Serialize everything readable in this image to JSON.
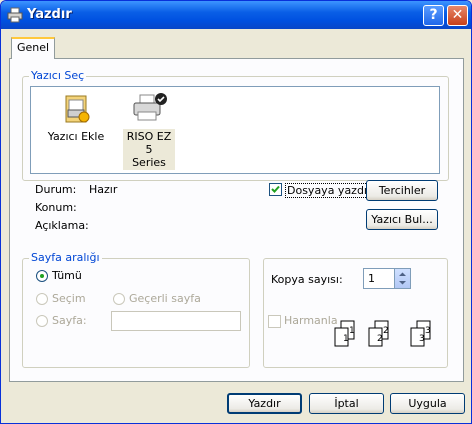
{
  "window": {
    "title": "Yazdır",
    "help_symbol": "?",
    "close_symbol": "✕"
  },
  "tabs": [
    {
      "label": "Genel"
    }
  ],
  "printer_group": {
    "title": "Yazıcı Seç",
    "printers": [
      {
        "name": "Yazıcı Ekle",
        "icon": "add-printer-icon"
      },
      {
        "name_line1": "RISO EZ 5",
        "name_line2": "Series",
        "icon": "printer-icon",
        "selected": true
      }
    ]
  },
  "status": {
    "durum_label": "Durum:",
    "durum_value": "Hazır",
    "konum_label": "Konum:",
    "aciklama_label": "Açıklama:"
  },
  "print_to_file": {
    "label": "Dosyaya yazdır",
    "checked": true
  },
  "buttons": {
    "preferences": "Tercihler",
    "find_printer": "Yazıcı Bul...",
    "print": "Yazdır",
    "cancel": "İptal",
    "apply": "Uygula"
  },
  "page_range": {
    "title": "Sayfa aralığı",
    "all": "Tümü",
    "selection": "Seçim",
    "current_page": "Geçerli sayfa",
    "pages": "Sayfa:",
    "pages_value": ""
  },
  "copies": {
    "label": "Kopya sayısı:",
    "value": "1",
    "collate_label": "Harmanla",
    "collate_checked": false,
    "page_numbers": [
      "1",
      "1",
      "2",
      "2",
      "3",
      "3"
    ]
  }
}
